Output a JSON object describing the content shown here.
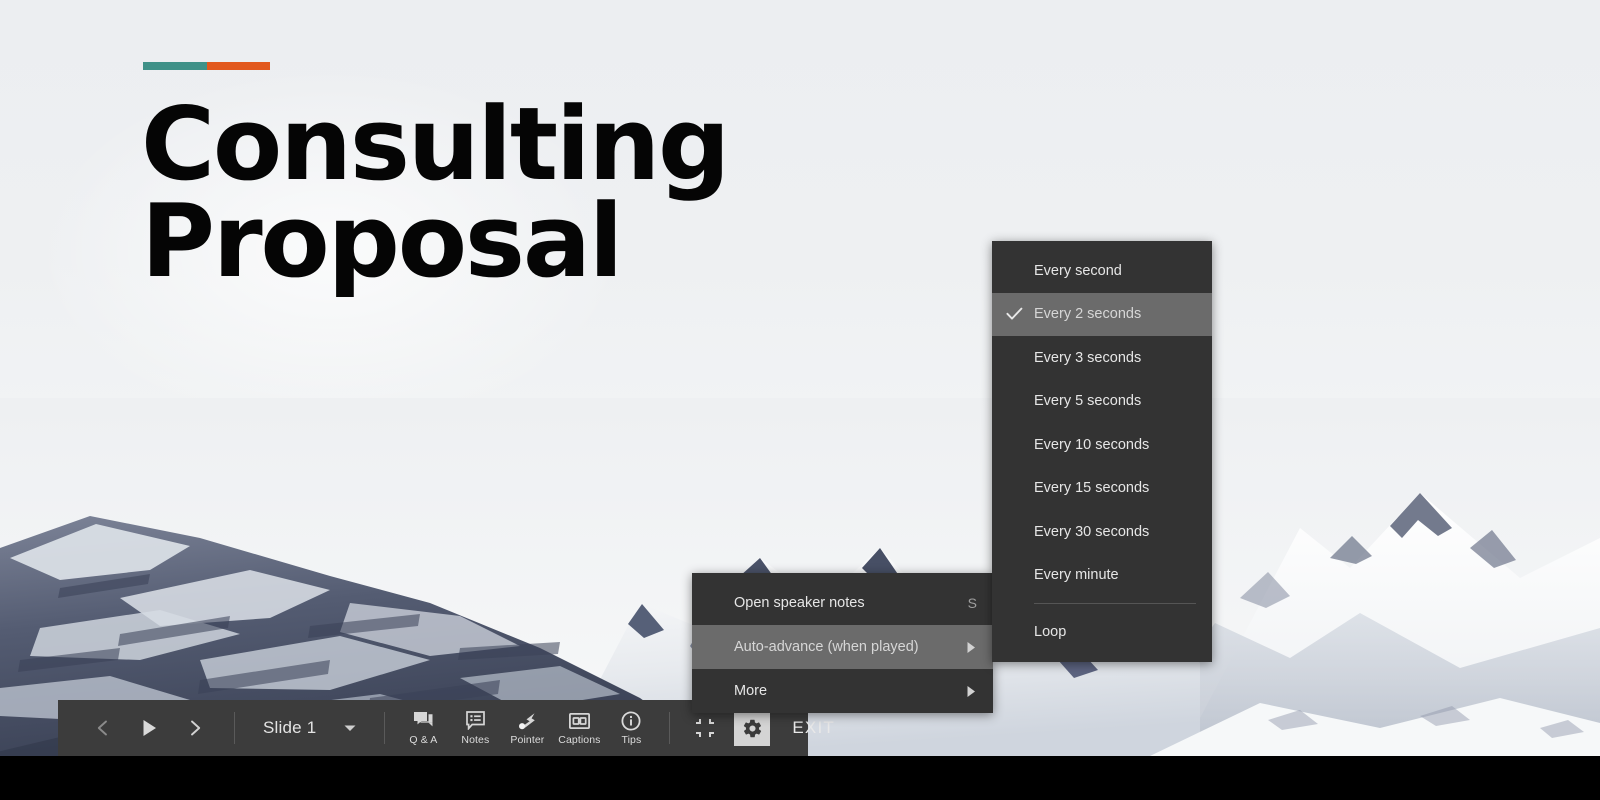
{
  "slide": {
    "title": "Consulting\nProposal",
    "accent": {
      "teal": "#3f9188",
      "orange": "#e2581d"
    },
    "background_image": "snowy-mountain-range-photo"
  },
  "toolbar": {
    "prev_icon": "chevron-left-icon",
    "play_icon": "play-icon",
    "next_icon": "chevron-right-icon",
    "slide_label": "Slide 1",
    "slide_dropdown_icon": "chevron-down-icon",
    "tools": [
      {
        "id": "qa",
        "icon": "speech-bubble-icon",
        "label": "Q & A"
      },
      {
        "id": "notes",
        "icon": "notes-icon",
        "label": "Notes"
      },
      {
        "id": "pointer",
        "icon": "laser-pointer-icon",
        "label": "Pointer"
      },
      {
        "id": "captions",
        "icon": "closed-caption-icon",
        "label": "Captions"
      },
      {
        "id": "tips",
        "icon": "info-circle-icon",
        "label": "Tips"
      }
    ],
    "fit_icon": "exit-fullscreen-icon",
    "gear_icon": "gear-icon",
    "exit_label": "EXIT"
  },
  "context_menu": {
    "items": [
      {
        "label": "Open speaker notes",
        "accel": "S",
        "submenu": false,
        "highlighted": false
      },
      {
        "label": "Auto-advance (when played)",
        "accel": "",
        "submenu": true,
        "highlighted": true
      },
      {
        "label": "More",
        "accel": "",
        "submenu": true,
        "highlighted": false
      }
    ]
  },
  "auto_advance_submenu": {
    "items": [
      {
        "label": "Every second",
        "checked": false,
        "highlighted": false
      },
      {
        "label": "Every 2 seconds",
        "checked": true,
        "highlighted": true
      },
      {
        "label": "Every 3 seconds",
        "checked": false,
        "highlighted": false
      },
      {
        "label": "Every 5 seconds",
        "checked": false,
        "highlighted": false
      },
      {
        "label": "Every 10 seconds",
        "checked": false,
        "highlighted": false
      },
      {
        "label": "Every 15 seconds",
        "checked": false,
        "highlighted": false
      },
      {
        "label": "Every 30 seconds",
        "checked": false,
        "highlighted": false
      },
      {
        "label": "Every minute",
        "checked": false,
        "highlighted": false
      }
    ],
    "divider_after_index": 7,
    "loop_label": "Loop"
  },
  "colors": {
    "menu_bg": "#333333",
    "menu_highlight": "#6b6b6b",
    "toolbar_bg": "#3c3c3c",
    "slide_bg": "#eceef0",
    "letterbox": "#000000"
  }
}
